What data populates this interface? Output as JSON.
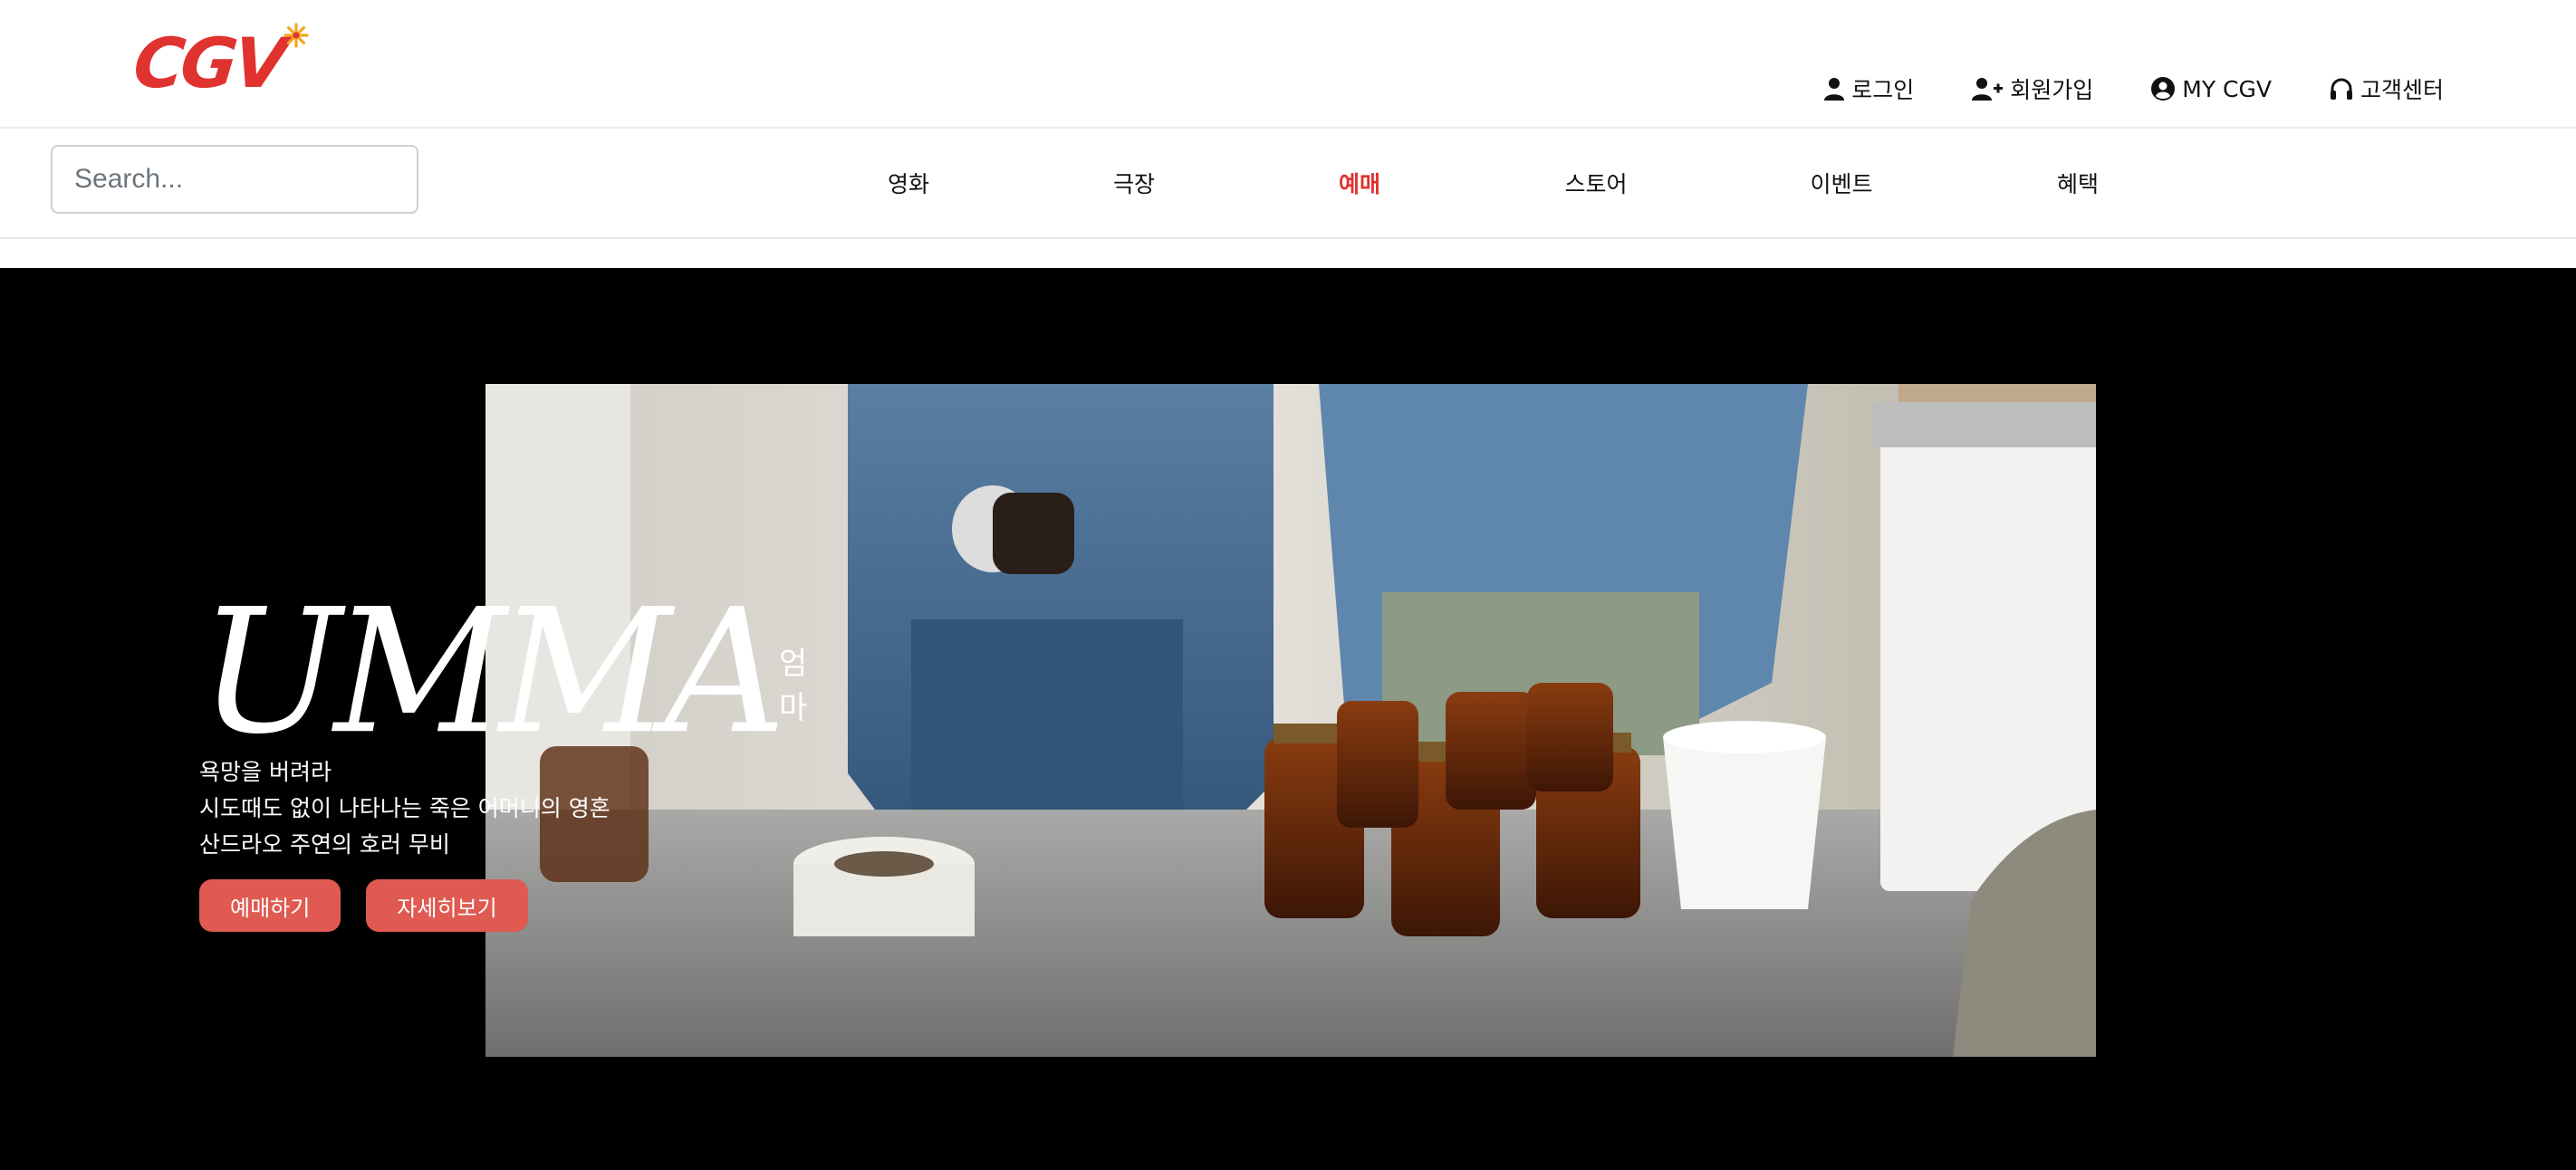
{
  "brand": {
    "logo_text": "CGV",
    "accent_color": "#e0322f"
  },
  "topnav": {
    "items": [
      {
        "label": "로그인",
        "icon": "user-icon"
      },
      {
        "label": "회원가입",
        "icon": "user-plus-icon"
      },
      {
        "label": "MY CGV",
        "icon": "user-circle-icon"
      },
      {
        "label": "고객센터",
        "icon": "headphones-icon"
      }
    ]
  },
  "search": {
    "placeholder": "Search...",
    "value": ""
  },
  "mainnav": {
    "items": [
      {
        "label": "영화",
        "active": false
      },
      {
        "label": "극장",
        "active": false
      },
      {
        "label": "예매",
        "active": true
      },
      {
        "label": "스토어",
        "active": false
      },
      {
        "label": "이벤트",
        "active": false
      },
      {
        "label": "혜택",
        "active": false
      }
    ]
  },
  "hero": {
    "title": "UMMA",
    "subtitle": "엄마",
    "description": [
      "욕망을 버려라",
      "시도때도 없이 나타나는 죽은 어머니의 영혼",
      "산드라오 주연의 호러 무비"
    ],
    "buttons": {
      "book": "예매하기",
      "details": "자세히보기"
    },
    "button_color": "#e05a52"
  }
}
